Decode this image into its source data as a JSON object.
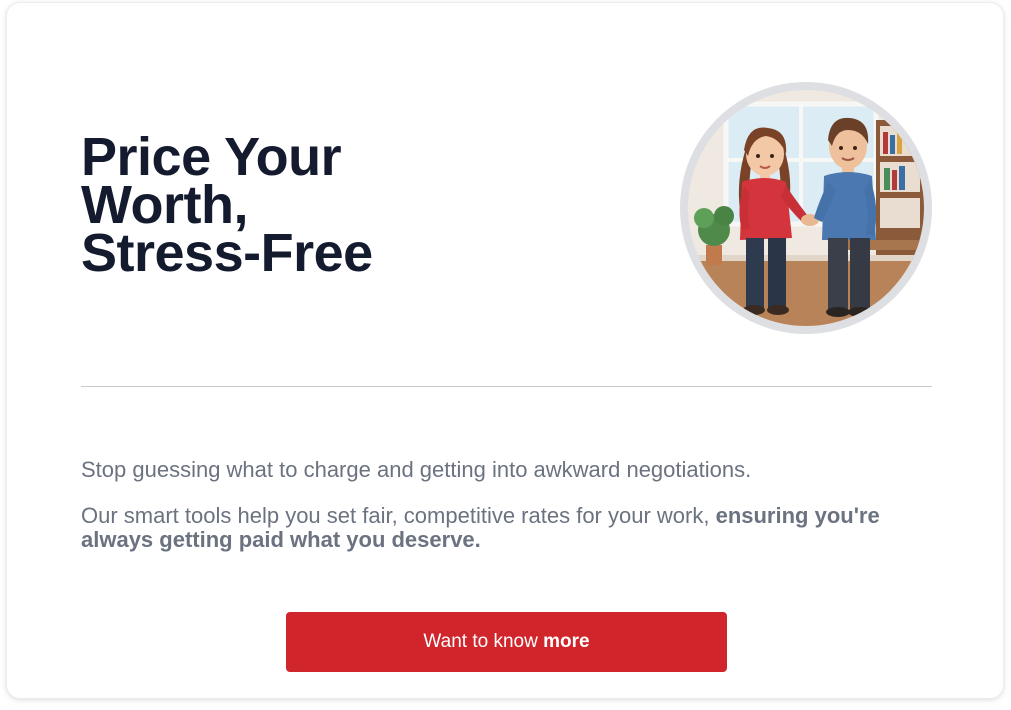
{
  "hero": {
    "title": "Price Your\nWorth,\nStress-Free",
    "image_alt": "Two people shaking hands in an office"
  },
  "body": {
    "paragraph_1": "Stop guessing what to charge and getting into awkward negotiations.",
    "paragraph_2_regular": "Our smart tools help you set fair, competitive rates for your work, ",
    "paragraph_2_bold": "ensuring you're always getting paid what you deserve."
  },
  "cta": {
    "label_regular": "Want to know ",
    "label_bold": "more"
  },
  "colors": {
    "title": "#141b2e",
    "body_text": "#6b7280",
    "accent": "#d0262b",
    "avatar_ring": "#dedfe3",
    "divider": "#c8c9cd"
  }
}
